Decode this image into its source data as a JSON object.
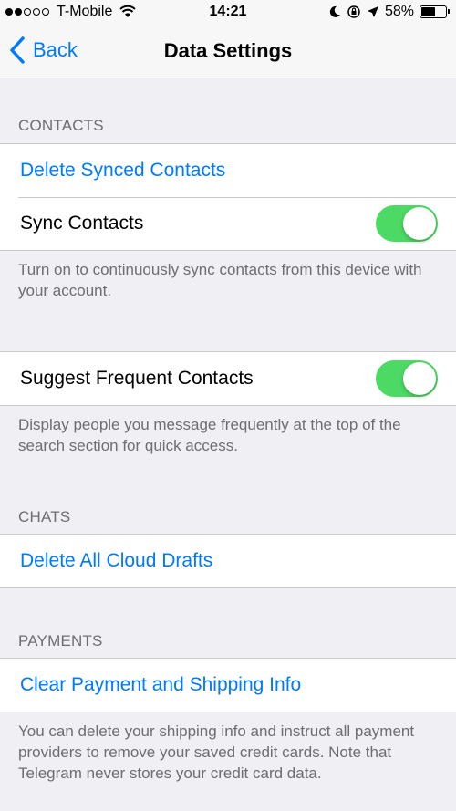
{
  "status_bar": {
    "carrier": "T-Mobile",
    "signal_bars_filled": 2,
    "signal_bars_total": 5,
    "time": "14:21",
    "battery_percent_label": "58%",
    "battery_level": 0.58
  },
  "nav": {
    "back_label": "Back",
    "title": "Data Settings"
  },
  "contacts": {
    "header": "CONTACTS",
    "delete_synced": "Delete Synced Contacts",
    "sync_label": "Sync Contacts",
    "sync_on": true,
    "sync_footer": "Turn on to continuously sync contacts from this device with your account.",
    "suggest_label": "Suggest Frequent Contacts",
    "suggest_on": true,
    "suggest_footer": "Display people you message frequently at the top of the search section for quick access."
  },
  "chats": {
    "header": "CHATS",
    "delete_drafts": "Delete All Cloud Drafts"
  },
  "payments": {
    "header": "PAYMENTS",
    "clear_info": "Clear Payment and Shipping Info",
    "footer": "You can delete your shipping info and instruct all payment providers to remove your saved credit cards. Note that Telegram never stores your credit card data."
  },
  "colors": {
    "accent": "#007aff",
    "toggle_on": "#4cd964",
    "background": "#efeff4",
    "section_text": "#6d6d72"
  }
}
